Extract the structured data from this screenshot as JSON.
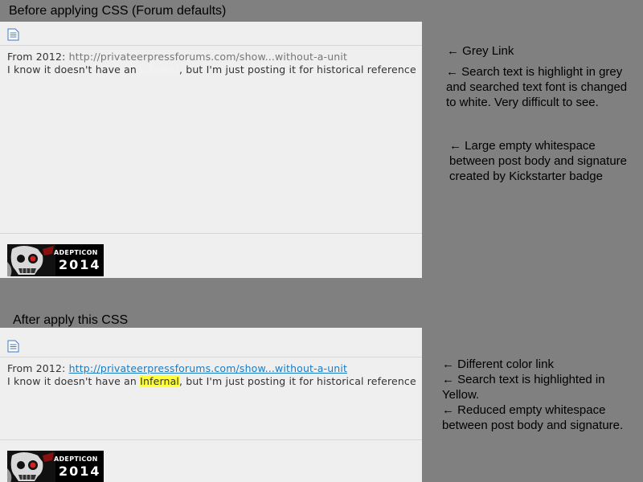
{
  "before": {
    "heading": "Before applying CSS (Forum defaults)",
    "from_prefix": "From 2012: ",
    "link_text": "http://privateerpressforums.com/show...without-a-unit",
    "body_prefix": "I know it doesn't have an ",
    "search_term": "Infernal",
    "body_suffix": ", but I'm just posting it for historical reference",
    "badge_top": "ADEPTICON",
    "badge_year": "2014"
  },
  "after": {
    "heading": "After apply this CSS",
    "from_prefix": "From 2012: ",
    "link_text": "http://privateerpressforums.com/show...without-a-unit",
    "body_prefix": "I know it doesn't have an ",
    "search_term": "Infernal",
    "body_suffix": ", but I'm just posting it for historical reference",
    "badge_top": "ADEPTICON",
    "badge_year": "2014"
  },
  "notes_before": {
    "grey_link": "← Grey Link",
    "search_1": "← Search text is highlight in grey",
    "search_2": "and searched text font is changed",
    "search_3": "to white. Very difficult to see.",
    "space_1": "← Large empty whitespace",
    "space_2": "between post body and signature",
    "space_3": "created by Kickstarter badge"
  },
  "notes_after": {
    "line_1": "← Different color link",
    "line_2": "← Search text is highlighted in",
    "line_3": "Yellow.",
    "line_4": "← Reduced empty whitespace",
    "line_5": "between post body and signature."
  },
  "colors": {
    "background": "#808080",
    "panel": "#efefef",
    "link_grey": "#777777",
    "link_blue": "#1a7cc5",
    "highlight_yellow": "#ffff33"
  },
  "icons": [
    "document-icon",
    "skull-icon"
  ]
}
